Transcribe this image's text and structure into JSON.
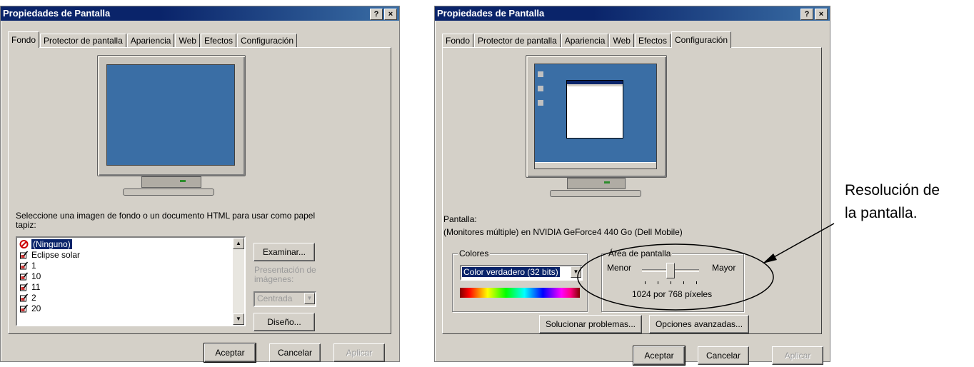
{
  "left": {
    "title": "Propiedades de Pantalla",
    "help_btn": "?",
    "close_btn": "×",
    "tabs": [
      "Fondo",
      "Protector de pantalla",
      "Apariencia",
      "Web",
      "Efectos",
      "Configuración"
    ],
    "wallpaper_label": "Seleccione una imagen de fondo o un documento HTML para usar como papel tapiz:",
    "list_items": [
      "(Ninguno)",
      "Eclipse solar",
      "1",
      "10",
      "11",
      "2",
      "20"
    ],
    "browse_btn": "Examinar...",
    "presentation_label": "Presentación de imágenes:",
    "presentation_value": "Centrada",
    "design_btn": "Diseño...",
    "ok": "Aceptar",
    "cancel": "Cancelar",
    "apply": "Aplicar"
  },
  "right": {
    "title": "Propiedades de Pantalla",
    "help_btn": "?",
    "close_btn": "×",
    "tabs": [
      "Fondo",
      "Protector de pantalla",
      "Apariencia",
      "Web",
      "Efectos",
      "Configuración"
    ],
    "display_label": "Pantalla:",
    "display_value": "(Monitores múltiple) en NVIDIA GeForce4 440 Go (Dell Mobile)",
    "colors_group": "Colores",
    "colors_value": "Color verdadero (32 bits)",
    "area_group": "Área de pantalla",
    "less": "Menor",
    "more": "Mayor",
    "resolution": "1024 por 768 píxeles",
    "troubleshoot_btn": "Solucionar problemas...",
    "advanced_btn": "Opciones avanzadas...",
    "ok": "Aceptar",
    "cancel": "Cancelar",
    "apply": "Aplicar"
  },
  "annotation": {
    "line1": "Resolución de",
    "line2": "la pantalla."
  },
  "colors": {
    "titlebar": "#0a246a",
    "dialog_bg": "#d4d0c8",
    "selection": "#0a246a",
    "desktop": "#3a6ea5"
  }
}
